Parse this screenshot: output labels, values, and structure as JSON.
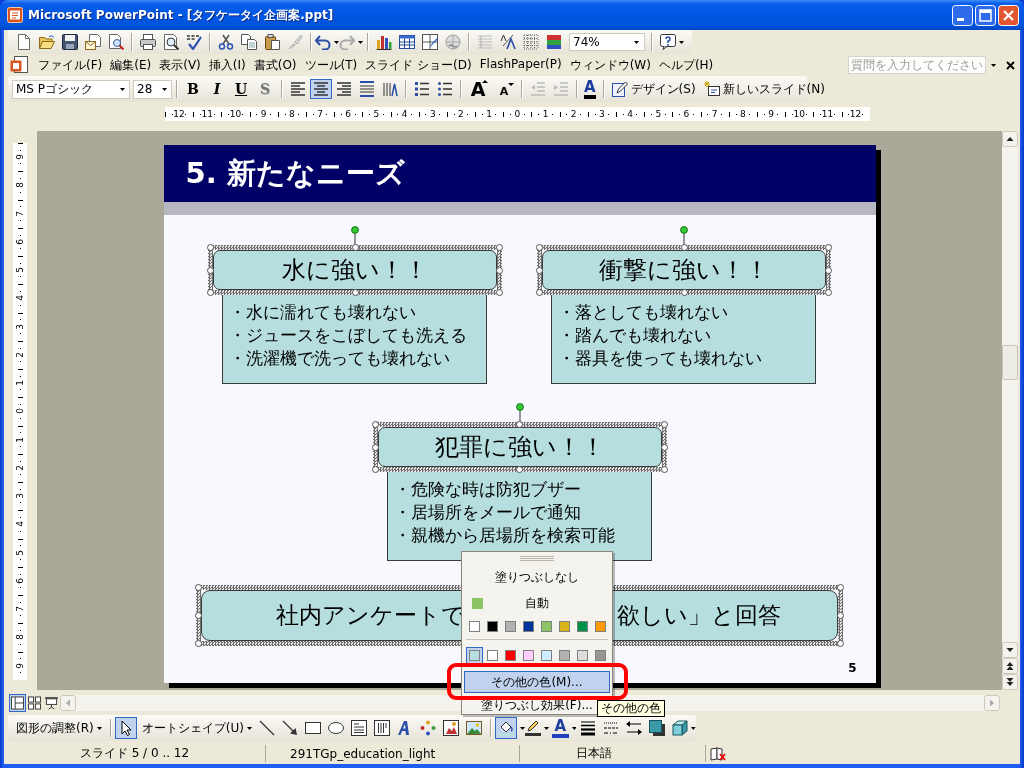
{
  "window": {
    "title": "Microsoft PowerPoint - [タフケータイ企画案.ppt]"
  },
  "standard_toolbar": {
    "zoom": "74%"
  },
  "menu_bar": {
    "items": [
      "ファイル(F)",
      "編集(E)",
      "表示(V)",
      "挿入(I)",
      "書式(O)",
      "ツール(T)",
      "スライド ショー(D)",
      "FlashPaper(P)",
      "ウィンドウ(W)",
      "ヘルプ(H)"
    ],
    "help_box": {
      "placeholder": "質問を入力してください"
    }
  },
  "formatting_toolbar": {
    "font": "MS Pゴシック",
    "font_size": "28",
    "style_buttons": [
      {
        "kind": "bold",
        "label": "B"
      },
      {
        "kind": "italic",
        "label": "I"
      },
      {
        "kind": "underline",
        "label": "U"
      },
      {
        "kind": "shadow",
        "label": "S"
      }
    ],
    "alignment": [
      {
        "selected": false
      },
      {
        "selected": true
      },
      {
        "selected": false
      }
    ],
    "font_grow": "A",
    "font_shrink": "A",
    "font_color": "A",
    "design": "デザイン(S)",
    "new_slide": "新しいスライド(N)"
  },
  "horizontal_ruler": {
    "labels": [
      "12",
      "11",
      "10",
      "9",
      "8",
      "7",
      "6",
      "5",
      "4",
      "3",
      "2",
      "1",
      "0",
      "1",
      "2",
      "3",
      "4",
      "5",
      "6",
      "7",
      "8",
      "9",
      "10",
      "11",
      "12"
    ]
  },
  "vertical_ruler": {
    "labels": [
      "9",
      "8",
      "7",
      "6",
      "5",
      "4",
      "3",
      "2",
      "1",
      "0",
      "1",
      "2",
      "3",
      "4",
      "5",
      "6",
      "7",
      "8",
      "9"
    ]
  },
  "slide": {
    "title": "5. 新たなニーズ",
    "cards": [
      {
        "heading": "水に強い！！",
        "selected": true,
        "bullets": [
          "・水に濡れても壊れない",
          "・ジュースをこぼしても洗える",
          "・洗濯機で洗っても壊れない"
        ]
      },
      {
        "heading": "衝撃に強い！！",
        "selected": true,
        "bullets": [
          "・落としても壊れない",
          "・踏んでも壊れない",
          "・器具を使っても壊れない"
        ]
      },
      {
        "heading": "犯罪に強い！！",
        "selected": true,
        "bullets": [
          "・危険な時は防犯ブザー",
          "・居場所をメールで通知",
          "・親機から居場所を検索可能"
        ]
      }
    ],
    "banner": {
      "text_left": "社内アンケートで",
      "text_right": "欲しい」と回答",
      "selected": true
    },
    "number": "5"
  },
  "view_buttons": [
    {
      "selected": true
    },
    {
      "selected": false
    },
    {
      "selected": false
    }
  ],
  "drawing_toolbar": {
    "draw_menu": "図形の調整(R)",
    "select_tool": {
      "selected": true
    },
    "autoshapes": "オートシェイプ(U)",
    "fill_color": {
      "selected": true
    },
    "font_color": "A"
  },
  "color_popup": {
    "no_fill": "塗りつぶしなし",
    "automatic": "自動",
    "standard_colors": [
      {
        "color": "#ffffff",
        "selected": false
      },
      {
        "color": "#000000",
        "selected": false
      },
      {
        "color": "#b2b2b2",
        "selected": false
      },
      {
        "color": "#003399",
        "selected": false
      },
      {
        "color": "#8cc466",
        "selected": false
      },
      {
        "color": "#d9b51c",
        "selected": false
      },
      {
        "color": "#009148",
        "selected": false
      },
      {
        "color": "#ff9900",
        "selected": false
      }
    ],
    "scheme_colors": [
      {
        "color": "#b6dede",
        "selected": true
      },
      {
        "color": "#ffffff",
        "selected": false
      },
      {
        "color": "#ff0000",
        "selected": false
      },
      {
        "color": "#ffccff",
        "selected": false
      },
      {
        "color": "#cceeff",
        "selected": false
      },
      {
        "color": "#b2b2b2",
        "selected": false
      },
      {
        "color": "#dddddd",
        "selected": false
      },
      {
        "color": "#969696",
        "selected": false
      }
    ],
    "more_colors": {
      "label": "その他の色(M)...",
      "selected": true
    },
    "fill_effects": "塗りつぶし効果(F)..."
  },
  "tooltip": {
    "text": "その他の色"
  },
  "status_bar": {
    "slide": "スライド 5 / 0 .. 12",
    "design": "291TGp_education_light",
    "language": "日本語"
  }
}
